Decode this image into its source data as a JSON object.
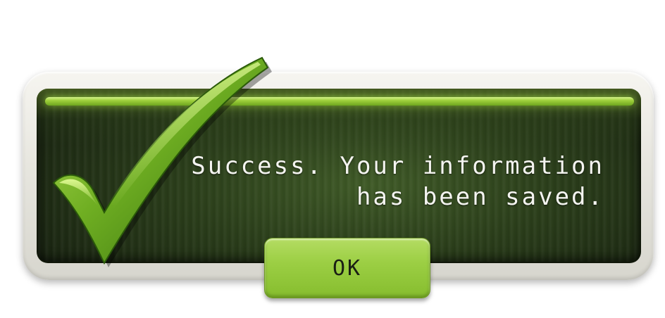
{
  "dialog": {
    "message_line1": "Success. Your information",
    "message_line2": "has been saved.",
    "ok_label": "OK",
    "icon": "checkmark-icon"
  },
  "colors": {
    "accent_green": "#9ccf44",
    "panel_dark": "#1b2612",
    "bezel": "#e7e6df",
    "text": "#f4f4f0"
  }
}
